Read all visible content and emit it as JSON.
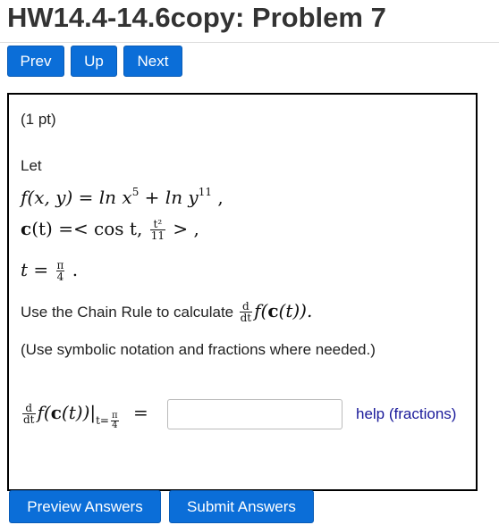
{
  "header": {
    "title": "HW14.4-14.6copy: Problem 7"
  },
  "nav": {
    "prev": "Prev",
    "up": "Up",
    "next": "Next"
  },
  "problem": {
    "points": "(1 pt)",
    "let": "Let",
    "f_lhs": "f(x, y) = ln x",
    "f_exp1": "5",
    "f_plus": " + ln y",
    "f_exp2": "11",
    "f_end": " ,",
    "c_lhs": "c",
    "c_rest": "(t) =< cos t,",
    "c_num": "t²",
    "c_den": "11",
    "c_end": " > ,",
    "t_lhs": "t =",
    "t_num": "π",
    "t_den": "4",
    "t_end": " .",
    "instruction": "Use the Chain Rule to calculate",
    "d_num": "d",
    "d_den": "dt",
    "expr_f": "f(",
    "expr_c": "c",
    "expr_t": "(t)).",
    "note": "(Use symbolic notation and fractions where needed.)",
    "ans_f": "f(",
    "ans_c": "c",
    "ans_t": "(t))|",
    "ans_sub": "t=",
    "ans_eq": "=",
    "answer_value": "",
    "help": "help (fractions)"
  },
  "footer": {
    "preview": "Preview Answers",
    "submit": "Submit Answers"
  }
}
